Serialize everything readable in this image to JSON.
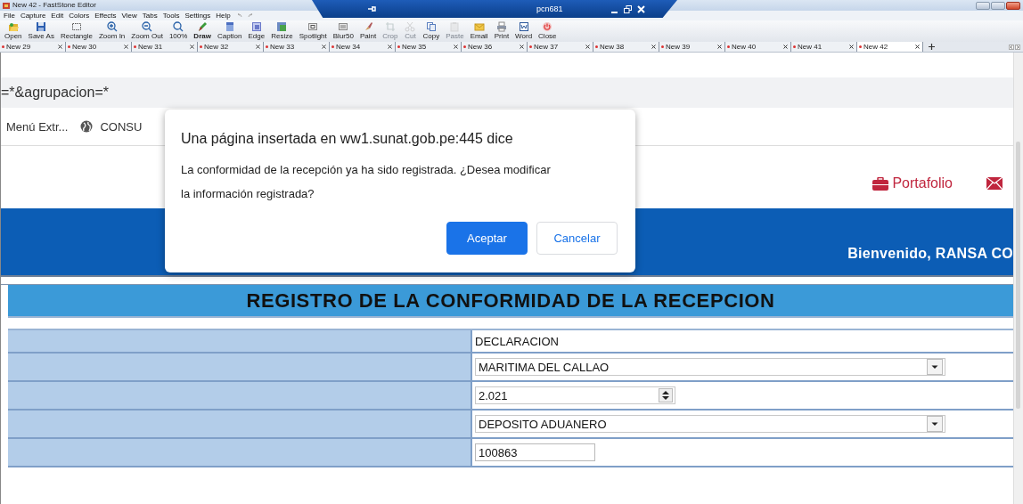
{
  "editor": {
    "title": "New 42 - FastStone Editor",
    "menu": [
      "File",
      "Capture",
      "Edit",
      "Colors",
      "Effects",
      "View",
      "Tabs",
      "Tools",
      "Settings",
      "Help"
    ],
    "toolbar": [
      {
        "label": "Open",
        "disabled": false
      },
      {
        "label": "Save As",
        "disabled": false
      },
      {
        "label": "Rectangle",
        "disabled": false
      },
      {
        "label": "Zoom In",
        "disabled": false
      },
      {
        "label": "Zoom Out",
        "disabled": false
      },
      {
        "label": "100%",
        "disabled": false
      },
      {
        "label": "Draw",
        "disabled": false
      },
      {
        "label": "Caption",
        "disabled": false
      },
      {
        "label": "Edge",
        "disabled": false
      },
      {
        "label": "Resize",
        "disabled": false
      },
      {
        "label": "Spotlight",
        "disabled": false
      },
      {
        "label": "Blur50",
        "disabled": false
      },
      {
        "label": "Paint",
        "disabled": false
      },
      {
        "label": "Crop",
        "disabled": true
      },
      {
        "label": "Cut",
        "disabled": true
      },
      {
        "label": "Copy",
        "disabled": false
      },
      {
        "label": "Paste",
        "disabled": true
      },
      {
        "label": "Email",
        "disabled": false
      },
      {
        "label": "Print",
        "disabled": false
      },
      {
        "label": "Word",
        "disabled": false
      },
      {
        "label": "Close",
        "disabled": false
      }
    ],
    "tabs": [
      {
        "label": "New 29",
        "selected": false
      },
      {
        "label": "New 30",
        "selected": false
      },
      {
        "label": "New 31",
        "selected": false
      },
      {
        "label": "New 32",
        "selected": false
      },
      {
        "label": "New 33",
        "selected": false
      },
      {
        "label": "New 34",
        "selected": false
      },
      {
        "label": "New 35",
        "selected": false
      },
      {
        "label": "New 36",
        "selected": false
      },
      {
        "label": "New 37",
        "selected": false
      },
      {
        "label": "New 38",
        "selected": false
      },
      {
        "label": "New 39",
        "selected": false
      },
      {
        "label": "New 40",
        "selected": false
      },
      {
        "label": "New 41",
        "selected": false
      },
      {
        "label": "New 42",
        "selected": true
      }
    ]
  },
  "remote_bar": {
    "title": "pcn681"
  },
  "browser": {
    "address": "=*&agrupacion=*",
    "bookmarks": [
      "Menú Extr...",
      "CONSU"
    ]
  },
  "site": {
    "header_link": "Portafolio",
    "welcome": "Bienvenido, RANSA CO",
    "form": {
      "title": "REGISTRO DE LA CONFORMIDAD DE LA RECEPCION",
      "rows": [
        {
          "kind": "text",
          "value": "DECLARACION"
        },
        {
          "kind": "select",
          "value": "MARITIMA DEL CALLAO"
        },
        {
          "kind": "spinner",
          "value": "2.021"
        },
        {
          "kind": "select",
          "value": "DEPOSITO ADUANERO"
        },
        {
          "kind": "input",
          "value": "100863"
        }
      ]
    }
  },
  "dialog": {
    "title": "Una página insertada en ww1.sunat.gob.pe:445 dice",
    "message": "La conformidad de la recepción ya ha sido registrada. ¿Desea modificar la información registrada?",
    "buttons": [
      {
        "label": "Aceptar",
        "primary": true
      },
      {
        "label": "Cancelar",
        "primary": false
      }
    ]
  }
}
